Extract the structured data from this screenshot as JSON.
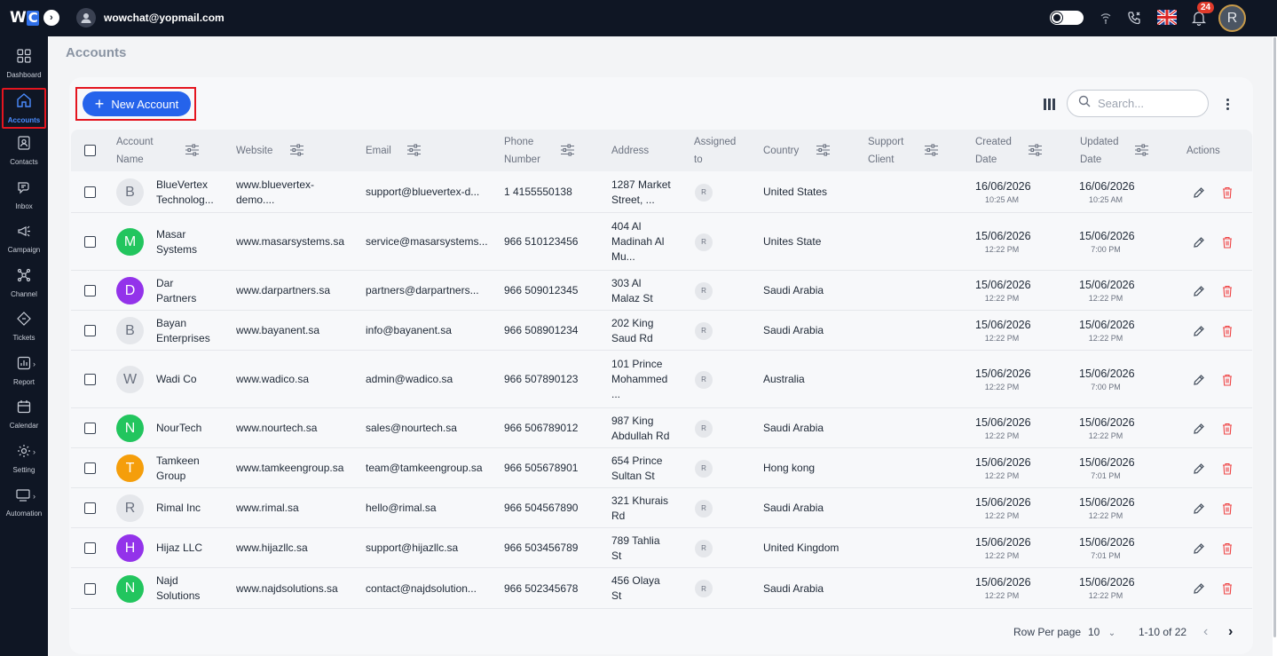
{
  "topbar": {
    "logo_text": "WC",
    "user_email": "wowchat@yopmail.com",
    "notification_count": "24",
    "avatar_initial": "R"
  },
  "sidebar": {
    "items": [
      {
        "label": "Dashboard",
        "icon": "dashboard-icon"
      },
      {
        "label": "Accounts",
        "icon": "home-icon",
        "active": true
      },
      {
        "label": "Contacts",
        "icon": "contacts-icon"
      },
      {
        "label": "Inbox",
        "icon": "inbox-icon"
      },
      {
        "label": "Campaign",
        "icon": "campaign-icon"
      },
      {
        "label": "Channel",
        "icon": "channel-icon"
      },
      {
        "label": "Tickets",
        "icon": "ticket-icon"
      },
      {
        "label": "Report",
        "icon": "report-icon"
      },
      {
        "label": "Calendar",
        "icon": "calendar-icon"
      },
      {
        "label": "Setting",
        "icon": "gear-icon"
      },
      {
        "label": "Automation",
        "icon": "automation-icon"
      }
    ]
  },
  "page": {
    "title": "Accounts",
    "new_button": "New Account",
    "search_placeholder": "Search..."
  },
  "table": {
    "headers": {
      "account_name_1": "Account",
      "account_name_2": "Name",
      "website": "Website",
      "email": "Email",
      "phone_1": "Phone",
      "phone_2": "Number",
      "address": "Address",
      "assigned_1": "Assigned",
      "assigned_2": "to",
      "country": "Country",
      "support_1": "Support",
      "support_2": "Client",
      "created_1": "Created",
      "created_2": "Date",
      "updated_1": "Updated",
      "updated_2": "Date",
      "actions": "Actions"
    },
    "rows": [
      {
        "initial": "B",
        "avatar_color": "",
        "name_1": "BlueVertex",
        "name_2": "Technolog...",
        "website_1": "www.bluevertex-",
        "website_2": "demo....",
        "email": "support@bluevertex-d...",
        "phone": "1 4155550138",
        "addr_1": "1287 Market",
        "addr_2": "Street, ...",
        "addr_3": "",
        "assigned": "R",
        "country": "United States",
        "created_date": "16/06/2026",
        "created_time": "10:25 AM",
        "updated_date": "16/06/2026",
        "updated_time": "10:25 AM"
      },
      {
        "initial": "M",
        "avatar_color": "#22c55e",
        "name_1": "Masar",
        "name_2": "Systems",
        "website_1": "www.masarsystems.sa",
        "website_2": "",
        "email": "service@masarsystems...",
        "phone": "966 510123456",
        "addr_1": "404 Al",
        "addr_2": "Madinah Al",
        "addr_3": "Mu...",
        "assigned": "R",
        "country": "Unites State",
        "created_date": "15/06/2026",
        "created_time": "12:22 PM",
        "updated_date": "15/06/2026",
        "updated_time": "7:00 PM"
      },
      {
        "initial": "D",
        "avatar_color": "#9333ea",
        "name_1": "Dar",
        "name_2": "Partners",
        "website_1": "www.darpartners.sa",
        "website_2": "",
        "email": "partners@darpartners...",
        "phone": "966 509012345",
        "addr_1": "303 Al",
        "addr_2": "Malaz St",
        "addr_3": "",
        "assigned": "R",
        "country": "Saudi Arabia",
        "created_date": "15/06/2026",
        "created_time": "12:22 PM",
        "updated_date": "15/06/2026",
        "updated_time": "12:22 PM"
      },
      {
        "initial": "B",
        "avatar_color": "",
        "name_1": "Bayan",
        "name_2": "Enterprises",
        "website_1": "www.bayanent.sa",
        "website_2": "",
        "email": "info@bayanent.sa",
        "phone": "966 508901234",
        "addr_1": "202 King",
        "addr_2": "Saud Rd",
        "addr_3": "",
        "assigned": "R",
        "country": "Saudi Arabia",
        "created_date": "15/06/2026",
        "created_time": "12:22 PM",
        "updated_date": "15/06/2026",
        "updated_time": "12:22 PM"
      },
      {
        "initial": "W",
        "avatar_color": "",
        "name_1": "Wadi Co",
        "name_2": "",
        "website_1": "www.wadico.sa",
        "website_2": "",
        "email": "admin@wadico.sa",
        "phone": "966 507890123",
        "addr_1": "101 Prince",
        "addr_2": "Mohammed",
        "addr_3": "...",
        "assigned": "R",
        "country": "Australia",
        "created_date": "15/06/2026",
        "created_time": "12:22 PM",
        "updated_date": "15/06/2026",
        "updated_time": "7:00 PM"
      },
      {
        "initial": "N",
        "avatar_color": "#22c55e",
        "name_1": "NourTech",
        "name_2": "",
        "website_1": "www.nourtech.sa",
        "website_2": "",
        "email": "sales@nourtech.sa",
        "phone": "966 506789012",
        "addr_1": "987 King",
        "addr_2": "Abdullah Rd",
        "addr_3": "",
        "assigned": "R",
        "country": "Saudi Arabia",
        "created_date": "15/06/2026",
        "created_time": "12:22 PM",
        "updated_date": "15/06/2026",
        "updated_time": "12:22 PM"
      },
      {
        "initial": "T",
        "avatar_color": "#f59e0b",
        "name_1": "Tamkeen",
        "name_2": "Group",
        "website_1": "www.tamkeengroup.sa",
        "website_2": "",
        "email": "team@tamkeengroup.sa",
        "phone": "966 505678901",
        "addr_1": "654 Prince",
        "addr_2": "Sultan St",
        "addr_3": "",
        "assigned": "R",
        "country": "Hong kong",
        "created_date": "15/06/2026",
        "created_time": "12:22 PM",
        "updated_date": "15/06/2026",
        "updated_time": "7:01 PM"
      },
      {
        "initial": "R",
        "avatar_color": "",
        "name_1": "Rimal Inc",
        "name_2": "",
        "website_1": "www.rimal.sa",
        "website_2": "",
        "email": "hello@rimal.sa",
        "phone": "966 504567890",
        "addr_1": "321 Khurais",
        "addr_2": "Rd",
        "addr_3": "",
        "assigned": "R",
        "country": "Saudi Arabia",
        "created_date": "15/06/2026",
        "created_time": "12:22 PM",
        "updated_date": "15/06/2026",
        "updated_time": "12:22 PM"
      },
      {
        "initial": "H",
        "avatar_color": "#9333ea",
        "name_1": "Hijaz LLC",
        "name_2": "",
        "website_1": "www.hijazllc.sa",
        "website_2": "",
        "email": "support@hijazllc.sa",
        "phone": "966 503456789",
        "addr_1": "789 Tahlia",
        "addr_2": "St",
        "addr_3": "",
        "assigned": "R",
        "country": "United Kingdom",
        "created_date": "15/06/2026",
        "created_time": "12:22 PM",
        "updated_date": "15/06/2026",
        "updated_time": "7:01 PM"
      },
      {
        "initial": "N",
        "avatar_color": "#22c55e",
        "name_1": "Najd",
        "name_2": "Solutions",
        "website_1": "www.najdsolutions.sa",
        "website_2": "",
        "email": "contact@najdsolution...",
        "phone": "966 502345678",
        "addr_1": "456 Olaya",
        "addr_2": "St",
        "addr_3": "",
        "assigned": "R",
        "country": "Saudi Arabia",
        "created_date": "15/06/2026",
        "created_time": "12:22 PM",
        "updated_date": "15/06/2026",
        "updated_time": "12:22 PM"
      }
    ]
  },
  "pagination": {
    "rows_per_page_label": "Row Per page",
    "rows_per_page_value": "10",
    "range": "1-10 of 22"
  },
  "colors": {
    "primary": "#2563eb",
    "sidebar_bg": "#0f1624",
    "highlight_outline": "#e4151f",
    "delete": "#ef4444"
  }
}
